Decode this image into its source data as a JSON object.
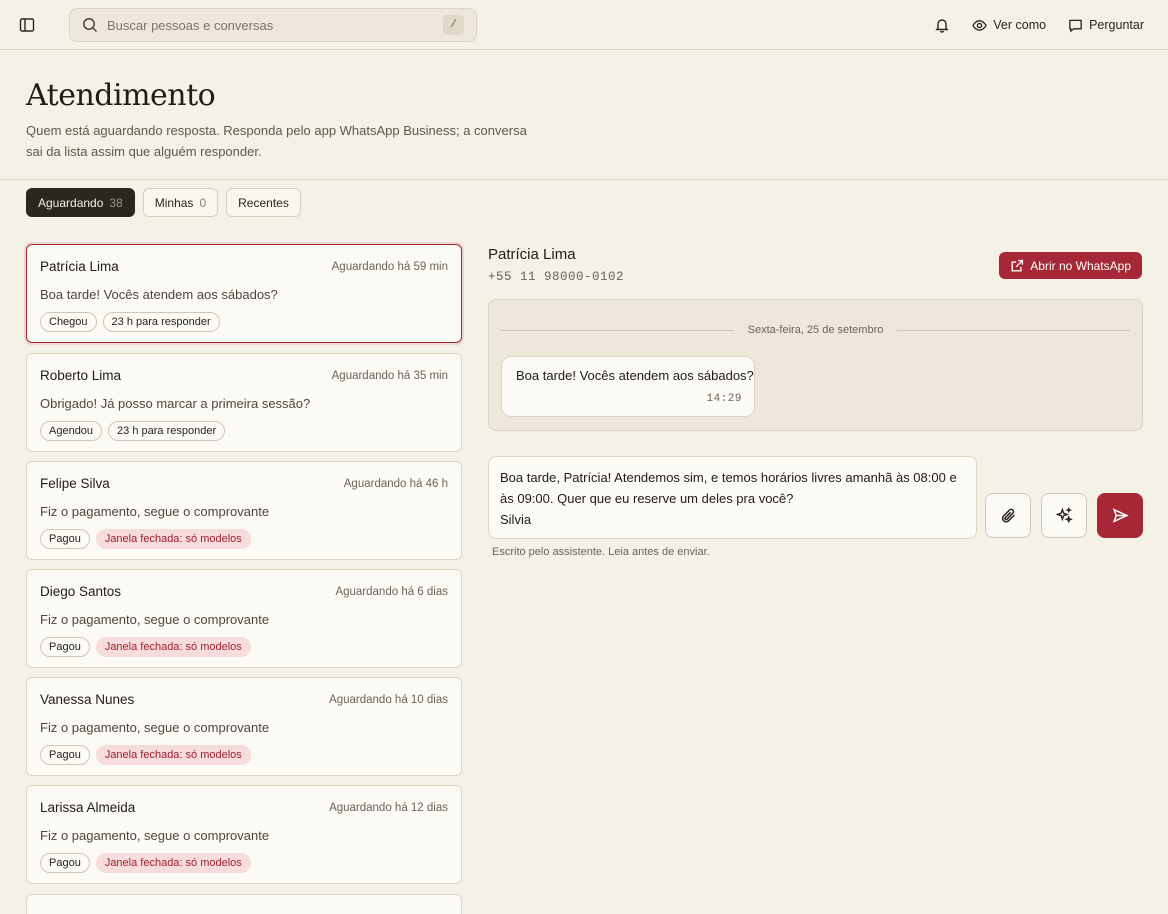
{
  "search": {
    "placeholder": "Buscar pessoas e conversas",
    "shortcut": "/"
  },
  "topbar": {
    "view_as": "Ver como",
    "ask": "Perguntar"
  },
  "header": {
    "title": "Atendimento",
    "description": "Quem está aguardando resposta. Responda pelo app WhatsApp Business; a conversa sai da lista assim que alguém responder."
  },
  "tabs": [
    {
      "label": "Aguardando",
      "count": "38"
    },
    {
      "label": "Minhas",
      "count": "0"
    },
    {
      "label": "Recentes",
      "count": ""
    }
  ],
  "conversations": [
    {
      "name": "Patrícia Lima",
      "wait": "Aguardando há 59 min",
      "message": "Boa tarde! Vocês atendem aos sábados?",
      "badge1": "Chegou",
      "badge2": "23 h para responder"
    },
    {
      "name": "Roberto Lima",
      "wait": "Aguardando há 35 min",
      "message": "Obrigado! Já posso marcar a primeira sessão?",
      "badge1": "Agendou",
      "badge2": "23 h para responder"
    },
    {
      "name": "Felipe Silva",
      "wait": "Aguardando há 46 h",
      "message": "Fiz o pagamento, segue o comprovante",
      "badge1": "Pagou",
      "badge2": "Janela fechada: só modelos"
    },
    {
      "name": "Diego Santos",
      "wait": "Aguardando há 6 dias",
      "message": "Fiz o pagamento, segue o comprovante",
      "badge1": "Pagou",
      "badge2": "Janela fechada: só modelos"
    },
    {
      "name": "Vanessa Nunes",
      "wait": "Aguardando há 10 dias",
      "message": "Fiz o pagamento, segue o comprovante",
      "badge1": "Pagou",
      "badge2": "Janela fechada: só modelos"
    },
    {
      "name": "Larissa Almeida",
      "wait": "Aguardando há 12 dias",
      "message": "Fiz o pagamento, segue o comprovante",
      "badge1": "Pagou",
      "badge2": "Janela fechada: só modelos"
    }
  ],
  "chat": {
    "contact_name": "Patrícia Lima",
    "contact_phone": "+55 11 98000-0102",
    "open_whatsapp": "Abrir no WhatsApp",
    "date_separator": "Sexta-feira, 25 de setembro",
    "message_text": "Boa tarde! Vocês atendem aos sábados?",
    "message_time": "14:29",
    "draft": "Boa tarde, Patrícia! Atendemos sim, e temos horários livres amanhã às 08:00 e às 09:00. Quer que eu reserve um deles pra você?\nSilvia",
    "hint": "Escrito pelo assistente. Leia antes de enviar."
  },
  "colors": {
    "accent": "#a62836",
    "background": "#f4f1e6",
    "warning_bg": "#f6dcdc"
  }
}
